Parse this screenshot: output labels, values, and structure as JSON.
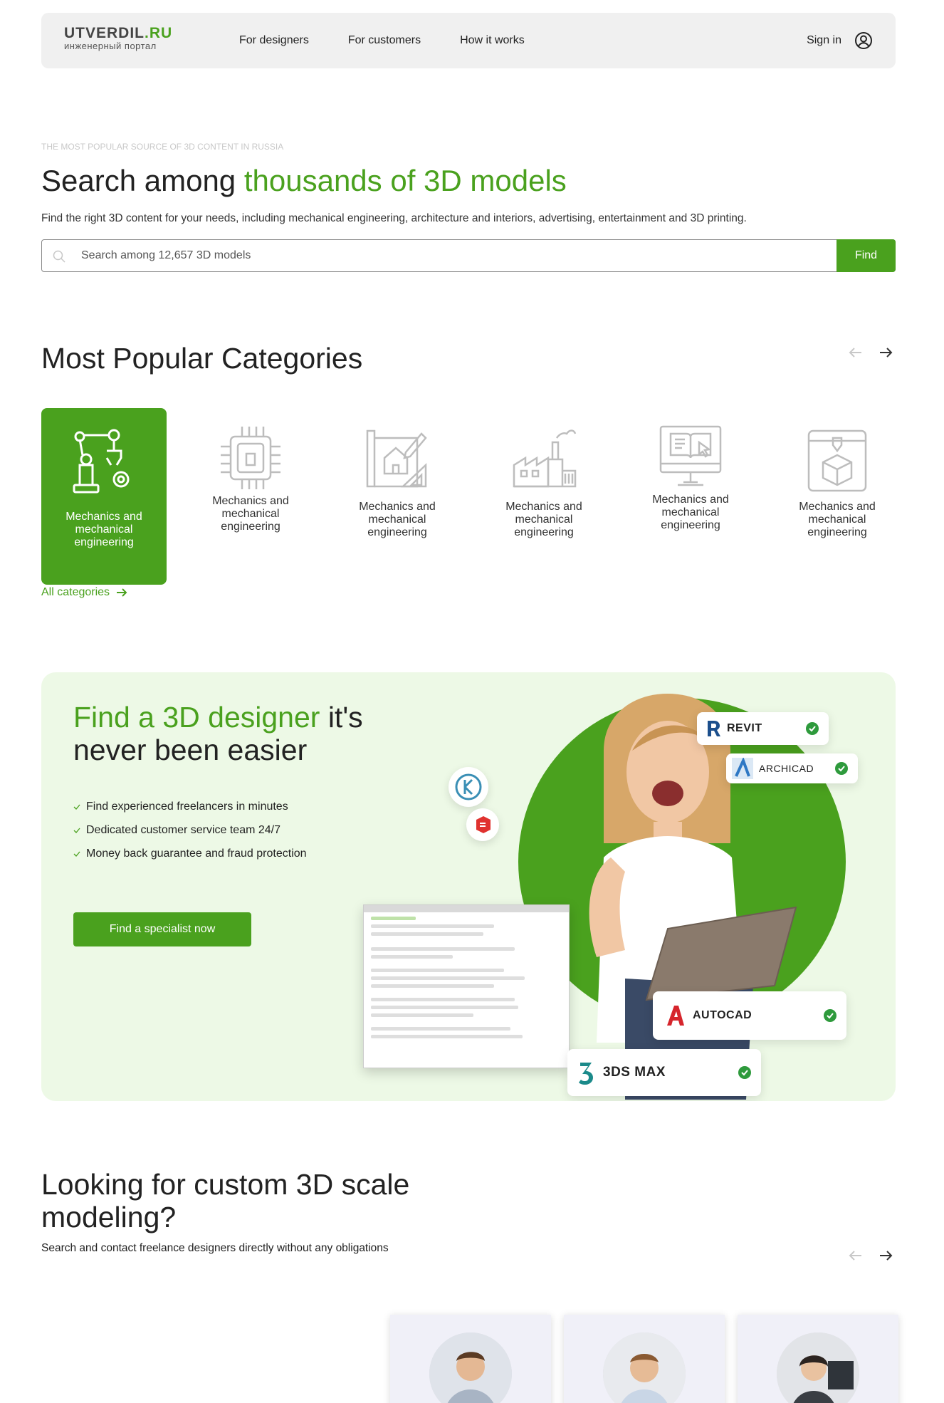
{
  "header": {
    "logo_main": "UTVERDIL",
    "logo_tld": ".RU",
    "logo_sub": "инженерный портал",
    "nav": [
      "For designers",
      "For customers",
      "How it works"
    ],
    "signin": "Sign in"
  },
  "hero": {
    "eyebrow": "THE MOST POPULAR SOURCE OF 3D CONTENT IN RUSSIA",
    "title_plain": "Search among ",
    "title_accent": "thousands of 3D models",
    "description": "Find the right 3D content for your needs, including mechanical engineering, architecture and interiors, advertising, entertainment and 3D printing.",
    "search_placeholder": "Search among 12,657 3D models",
    "find_label": "Find"
  },
  "categories": {
    "title": "Most Popular Categories",
    "items": [
      {
        "label": "Mechanics and mechanical engineering",
        "icon": "robot-arm-icon",
        "active": true
      },
      {
        "label": "Mechanics and mechanical engineering",
        "icon": "chip-icon",
        "active": false
      },
      {
        "label": "Mechanics and mechanical engineering",
        "icon": "blueprint-house-icon",
        "active": false
      },
      {
        "label": "Mechanics and mechanical engineering",
        "icon": "factory-icon",
        "active": false
      },
      {
        "label": "Mechanics and mechanical engineering",
        "icon": "monitor-book-icon",
        "active": false
      },
      {
        "label": "Mechanics and mechanical engineering",
        "icon": "3d-printer-icon",
        "active": false
      }
    ],
    "all_label": "All categories"
  },
  "designer_banner": {
    "title_accent": "Find a 3D designer",
    "title_rest_1": " it's",
    "title_rest_2": "never been easier",
    "benefits": [
      "Find experienced freelancers in minutes",
      "Dedicated customer service team 24/7",
      "Money back guarantee and fraud protection"
    ],
    "button": "Find a specialist now",
    "badges": {
      "revit": "REVIT",
      "archicad": "ARCHICAD",
      "autocad": "AUTOCAD",
      "max": "3DS MAX"
    },
    "colors": {
      "accent": "#4aa11e",
      "background": "#edf9e6"
    }
  },
  "custom": {
    "title_1": "Looking for custom 3D scale",
    "title_2": "modeling?",
    "description": "Search and contact freelance designers directly without any obligations"
  }
}
